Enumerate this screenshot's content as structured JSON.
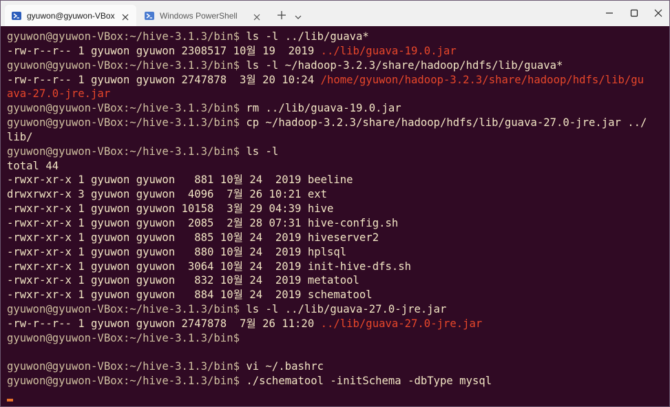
{
  "tabs": [
    {
      "label": "gyuwon@gyuwon-VBox: ~/h",
      "active": true,
      "icon": "powershell-icon"
    },
    {
      "label": "Windows PowerShell",
      "active": false,
      "icon": "powershell-icon"
    }
  ],
  "window_controls": {
    "minimize": "minimize-icon",
    "maximize": "maximize-icon",
    "close": "close-icon"
  },
  "colors": {
    "terminal_bg": "#300a24",
    "text": "#f2e5c4",
    "link_red": "#e8472a",
    "cursor": "#e8732a"
  },
  "terminal": {
    "lines": [
      {
        "prompt": "gyuwon@gyuwon-VBox:~/hive-3.1.3/bin$ ",
        "cmd": "ls -l ../lib/guava*"
      },
      {
        "text": "-rw-r--r-- 1 gyuwon gyuwon 2308517 10월 19  2019 ",
        "red": "../lib/guava-19.0.jar"
      },
      {
        "prompt": "gyuwon@gyuwon-VBox:~/hive-3.1.3/bin$ ",
        "cmd": "ls -l ~/hadoop-3.2.3/share/hadoop/hdfs/lib/guava*"
      },
      {
        "text": "-rw-r--r-- 1 gyuwon gyuwon 2747878  3월 20 10:24 ",
        "red": "/home/gyuwon/hadoop-3.2.3/share/hadoop/hdfs/lib/gu"
      },
      {
        "red": "ava-27.0-jre.jar"
      },
      {
        "prompt": "gyuwon@gyuwon-VBox:~/hive-3.1.3/bin$ ",
        "cmd": "rm ../lib/guava-19.0.jar"
      },
      {
        "prompt": "gyuwon@gyuwon-VBox:~/hive-3.1.3/bin$ ",
        "cmd": "cp ~/hadoop-3.2.3/share/hadoop/hdfs/lib/guava-27.0-jre.jar ../"
      },
      {
        "text": "lib/"
      },
      {
        "prompt": "gyuwon@gyuwon-VBox:~/hive-3.1.3/bin$ ",
        "cmd": "ls -l"
      },
      {
        "text": "total 44"
      },
      {
        "text": "-rwxr-xr-x 1 gyuwon gyuwon   881 10월 24  2019 beeline"
      },
      {
        "text": "drwxrwxr-x 3 gyuwon gyuwon  4096  7월 26 10:21 ext"
      },
      {
        "text": "-rwxr-xr-x 1 gyuwon gyuwon 10158  3월 29 04:39 hive"
      },
      {
        "text": "-rwxr-xr-x 1 gyuwon gyuwon  2085  2월 28 07:31 hive-config.sh"
      },
      {
        "text": "-rwxr-xr-x 1 gyuwon gyuwon   885 10월 24  2019 hiveserver2"
      },
      {
        "text": "-rwxr-xr-x 1 gyuwon gyuwon   880 10월 24  2019 hplsql"
      },
      {
        "text": "-rwxr-xr-x 1 gyuwon gyuwon  3064 10월 24  2019 init-hive-dfs.sh"
      },
      {
        "text": "-rwxr-xr-x 1 gyuwon gyuwon   832 10월 24  2019 metatool"
      },
      {
        "text": "-rwxr-xr-x 1 gyuwon gyuwon   884 10월 24  2019 schematool"
      },
      {
        "prompt": "gyuwon@gyuwon-VBox:~/hive-3.1.3/bin$ ",
        "cmd": "ls -l ../lib/guava-27.0-jre.jar"
      },
      {
        "text": "-rw-r--r-- 1 gyuwon gyuwon 2747878  7월 26 11:20 ",
        "red": "../lib/guava-27.0-jre.jar"
      },
      {
        "prompt": "gyuwon@gyuwon-VBox:~/hive-3.1.3/bin$ ",
        "cmd": ""
      },
      {
        "text": ""
      },
      {
        "prompt": "gyuwon@gyuwon-VBox:~/hive-3.1.3/bin$ ",
        "cmd": "vi ~/.bashrc"
      },
      {
        "prompt": "gyuwon@gyuwon-VBox:~/hive-3.1.3/bin$ ",
        "cmd": "./schematool -initSchema -dbType mysql"
      }
    ]
  }
}
